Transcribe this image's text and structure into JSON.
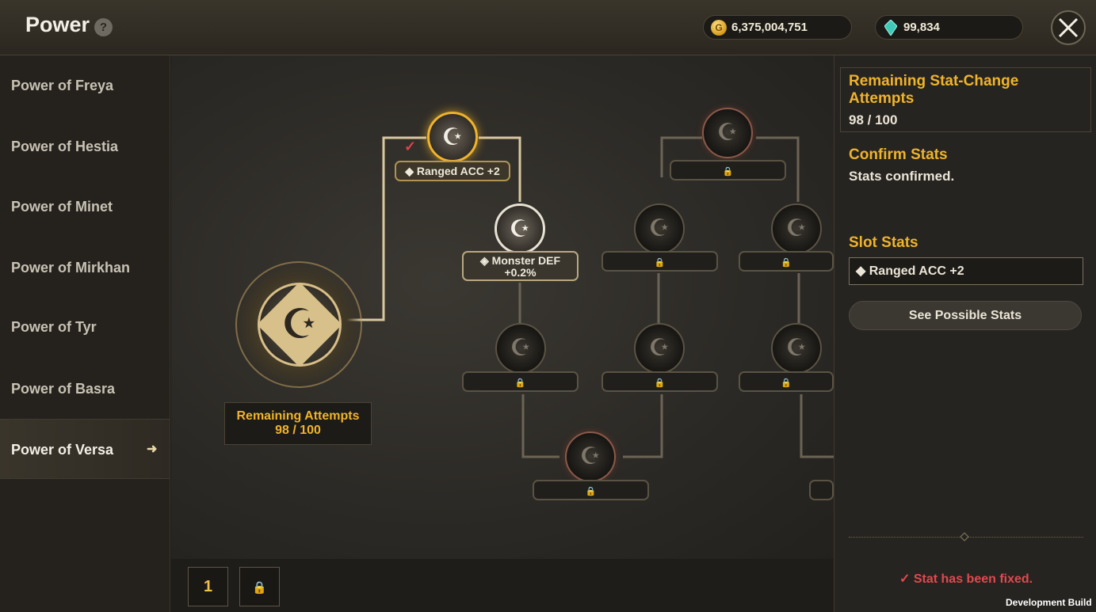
{
  "header": {
    "title": "Power",
    "help_label": "?",
    "gold": "6,375,004,751",
    "gems": "99,834"
  },
  "sidebar": {
    "items": [
      {
        "label": "Power of Freya"
      },
      {
        "label": "Power of Hestia"
      },
      {
        "label": "Power of Minet"
      },
      {
        "label": "Power of Mirkhan"
      },
      {
        "label": "Power of Tyr"
      },
      {
        "label": "Power of Basra"
      },
      {
        "label": "Power of Versa",
        "active": true
      }
    ]
  },
  "tree": {
    "remaining_label": "Remaining Attempts",
    "remaining_value": "98 / 100",
    "node_selected_tag": "◆ Ranged ACC +2",
    "node_second_tag_line1": "◈ Monster DEF",
    "node_second_tag_line2": "+0.2%",
    "lock_glyph": "🔒"
  },
  "pages": {
    "page1": "1"
  },
  "right_panel": {
    "stat_change_title": "Remaining Stat-Change Attempts",
    "stat_change_value": "98 / 100",
    "confirm_title": "Confirm Stats",
    "confirm_text": "Stats confirmed.",
    "slot_title": "Slot Stats",
    "slot_value": "◆ Ranged ACC +2",
    "possible_button": "See Possible Stats",
    "fixed_message": "✓ Stat has been fixed."
  },
  "footer": {
    "dev_build": "Development Build"
  },
  "colors": {
    "accent": "#f0b32c",
    "alert": "#e2484f"
  }
}
